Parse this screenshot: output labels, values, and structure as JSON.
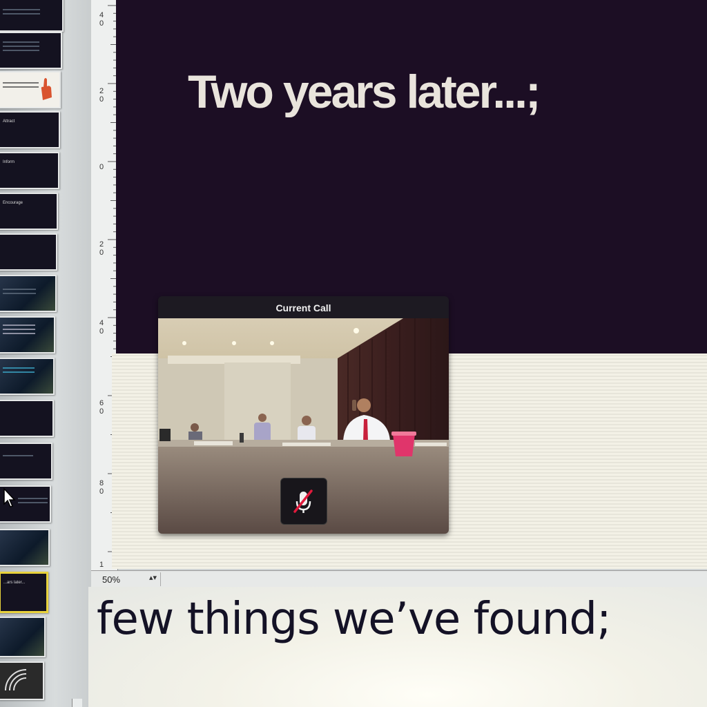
{
  "slide": {
    "title": "Two years later...;"
  },
  "call": {
    "title": "Current Call",
    "mute_icon": "microphone-muted-icon"
  },
  "zoom": {
    "value": "50%",
    "arrows": "▴▾"
  },
  "notes": {
    "text": "few things we’ve found;"
  },
  "ruler": {
    "labels": [
      "4 0",
      "2 0",
      "0",
      "2 0",
      "4 0",
      "6 0",
      "8 0",
      "1"
    ]
  },
  "thumbnails": [
    {
      "label": ""
    },
    {
      "label": ""
    },
    {
      "label": ""
    },
    {
      "label": "Attract"
    },
    {
      "label": "Inform"
    },
    {
      "label": "Encourage"
    },
    {
      "label": ""
    },
    {
      "label": ""
    },
    {
      "label": ""
    },
    {
      "label": ""
    },
    {
      "label": ""
    },
    {
      "label": ""
    },
    {
      "label": ""
    },
    {
      "label": ""
    },
    {
      "label": "...ars later..."
    },
    {
      "label": ""
    },
    {
      "label": ""
    }
  ],
  "colors": {
    "slide_dark": "#1c0e24",
    "title_text": "#e9e4dc",
    "active_thumb_border": "#e8d23c",
    "cup": "#e0356b"
  }
}
